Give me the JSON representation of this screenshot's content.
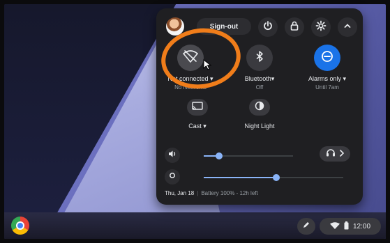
{
  "top_row": {
    "sign_out_label": "Sign-out",
    "power_icon": "power-icon",
    "lock_icon": "lock-icon",
    "settings_icon": "gear-icon",
    "collapse_icon": "chevron-up-icon"
  },
  "tiles": {
    "wifi": {
      "label": "Not connected ▾",
      "sub": "No Networks",
      "icon": "wifi-off-icon",
      "active": false
    },
    "bluetooth": {
      "label": "Bluetooth▾",
      "sub": "Off",
      "icon": "bluetooth-icon",
      "active": false
    },
    "dnd": {
      "label": "Alarms only ▾",
      "sub": "Until 7am",
      "icon": "do-not-disturb-icon",
      "active": true
    },
    "cast": {
      "label": "Cast ▾",
      "sub": "",
      "icon": "cast-icon",
      "active": false
    },
    "night_light": {
      "label": "Night Light",
      "sub": "",
      "icon": "night-light-icon",
      "active": false
    }
  },
  "sliders": {
    "volume": {
      "icon": "volume-icon",
      "level": 0.17
    },
    "brightness": {
      "icon": "brightness-icon",
      "level": 0.52
    }
  },
  "audio_settings_icon": "headphones-icon",
  "footer": {
    "date": "Thu, Jan 18",
    "battery": "Battery 100% - 12h left"
  },
  "shelf": {
    "launcher_icon": "chrome-icon",
    "pen_icon": "stylus-icon",
    "wifi_icon": "wifi-icon",
    "battery_icon": "battery-icon",
    "time": "12:00"
  },
  "colors": {
    "panel_bg": "#1f1f22",
    "accent_blue": "#1a73e8",
    "slider_blue": "#8ab4f8",
    "annotation_orange": "#f07d1a"
  }
}
